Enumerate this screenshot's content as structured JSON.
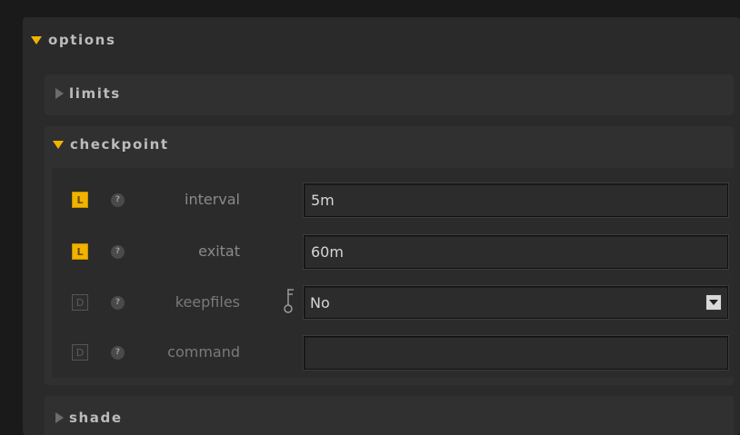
{
  "options": {
    "title": "options",
    "sections": {
      "limits": {
        "title": "limits"
      },
      "checkpoint": {
        "title": "checkpoint",
        "params": [
          {
            "button": "L",
            "help": "?",
            "label": "interval",
            "value": "5m"
          },
          {
            "button": "L",
            "help": "?",
            "label": "exitat",
            "value": "60m"
          },
          {
            "button": "D",
            "help": "?",
            "label": "keepfiles",
            "value": "No"
          },
          {
            "button": "D",
            "help": "?",
            "label": "command",
            "value": ""
          }
        ]
      },
      "shade": {
        "title": "shade"
      }
    }
  },
  "colors": {
    "accent": "#f0b400",
    "panel": "#2a2a2a",
    "background": "#1a1a1a"
  },
  "icons": {
    "expanded": "triangle-down-icon",
    "collapsed": "triangle-right-icon",
    "help": "help-icon",
    "key": "key-icon",
    "dropdown": "dropdown-arrow-icon"
  }
}
